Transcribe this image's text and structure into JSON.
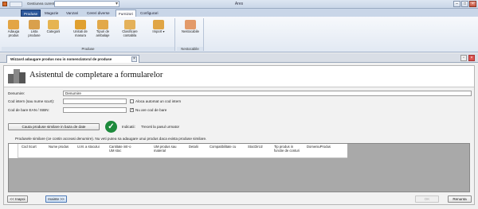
{
  "titlebar": {
    "gestiune_label": "Gestiunea curenta",
    "gestiune_value": "",
    "title": "Ares"
  },
  "ribbon": {
    "tabs": [
      "Produse",
      "Magazie",
      "Vanzari",
      "Cereri diverse",
      "Furnizori",
      "Configurari"
    ],
    "active_tab": "Furnizori",
    "selected_tab": "Produse",
    "group_produse": {
      "label": "Produse",
      "buttons": [
        "Adauga produs",
        "Lista produse",
        "Categorii",
        "Unitati de masura",
        "Tipuri de ambalaje",
        "Clasificare contabila",
        "Import"
      ]
    },
    "group_nestocabile": {
      "label": "Nestocabile",
      "buttons": [
        "Nestocabile"
      ]
    }
  },
  "document_tab": {
    "label": "Wizzard adaugare produs nou in nomenclatorul de produse"
  },
  "wizard": {
    "heading": "Asistentul de completare a formularelor",
    "denumire_label": "Denumire:",
    "denumire_value": "Denumire",
    "cod_intern_label": "Cod intern (sau nume scurt):",
    "cod_intern_value": "",
    "aloca_auto_label": "Aloca automat un cod intern",
    "aloca_auto_checked": false,
    "cod_bare_label": "Cod de bare EAN / ISBN:",
    "cod_bare_value": "",
    "nu_are_cod_label": "Nu are cod de bare",
    "nu_are_cod_checked": true,
    "cauta_button": "Cauta produse similare in baza de date",
    "indicatii_label": "Indicatii:",
    "indicatii_text": "Treceti la pasul urmator",
    "similar_info": "Produsele similare (ce contin acceasi denumire). Nu veti putea sa adaugare unui produs daca exista produse similare.",
    "columns": [
      "Cod Scurt",
      "Nume produs",
      "U.M. a stocului",
      "Cantitate intr-o UM stoc",
      "UM produs sau material",
      "Detalii",
      "Compatibilitate cu",
      "StocDirUz",
      "Tip produs in functie de conturi",
      "DomeniuProdus"
    ]
  },
  "footer": {
    "back_button": "<< Inapoi",
    "next_button": "Inainte >>",
    "finish_button": "OK",
    "cancel_button": "Renunta"
  },
  "colors": {
    "produse_tab": "#2b579a",
    "ok_check": "#1d8a3c"
  }
}
